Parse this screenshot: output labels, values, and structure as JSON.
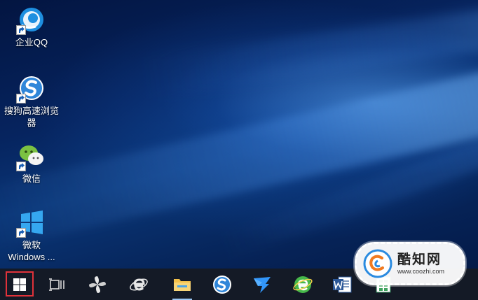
{
  "desktop": {
    "icons": [
      {
        "label": "企业QQ"
      },
      {
        "label": "搜狗高速浏览\n器"
      },
      {
        "label": "微信"
      },
      {
        "label": "微软\nWindows ..."
      }
    ]
  },
  "taskbar": {
    "items": [
      {
        "name": "start-button"
      },
      {
        "name": "task-view"
      },
      {
        "name": "app-pinwheel"
      },
      {
        "name": "internet-explorer"
      },
      {
        "name": "file-explorer"
      },
      {
        "name": "sogou-browser"
      },
      {
        "name": "dingtalk"
      },
      {
        "name": "360-browser"
      },
      {
        "name": "word"
      },
      {
        "name": "excel"
      }
    ]
  },
  "watermark": {
    "title": "酷知网",
    "url": "www.coozhi.com"
  },
  "colors": {
    "start_highlight": "#e0323a",
    "taskbar": "#141a26"
  }
}
